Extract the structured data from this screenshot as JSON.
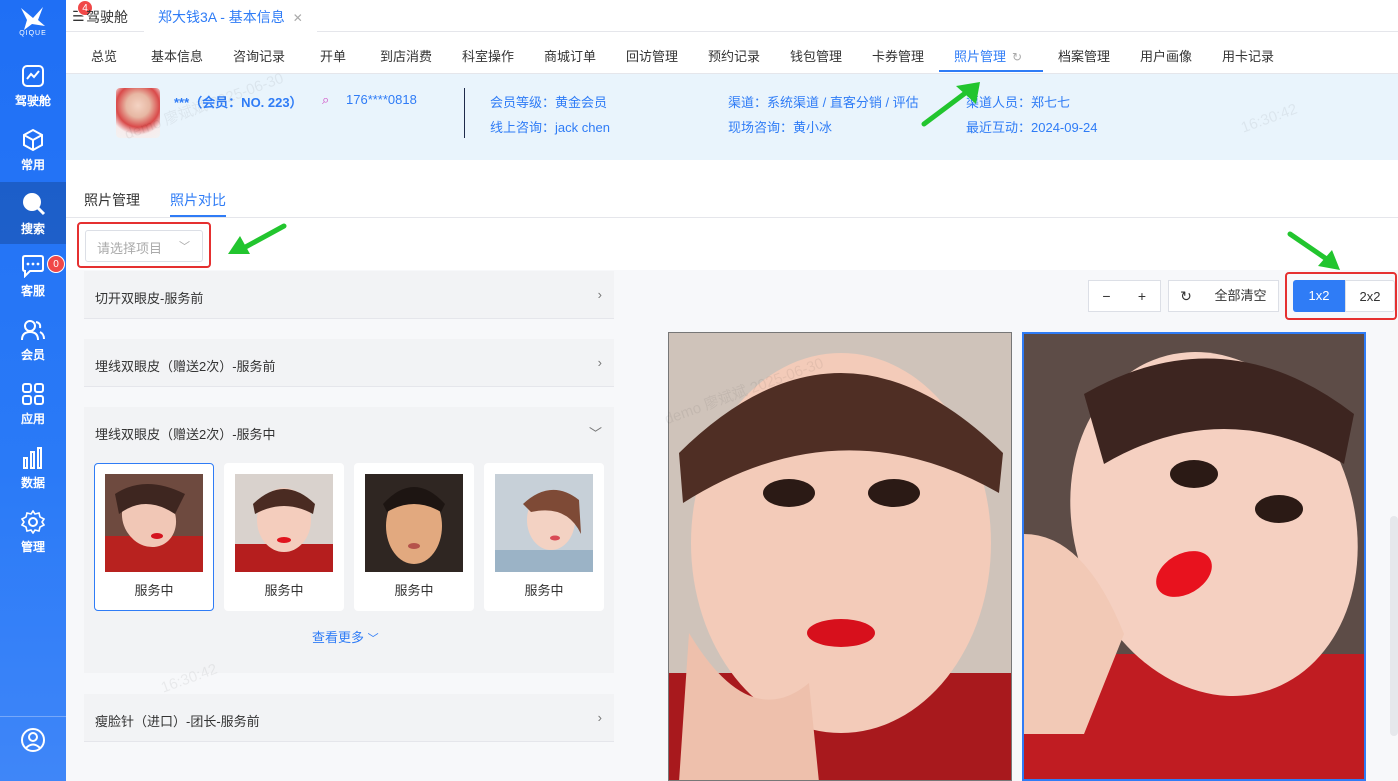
{
  "sidebar": {
    "logo_text": "QIQUE",
    "items": [
      {
        "label": "驾驶舱",
        "icon": "dashboard-icon"
      },
      {
        "label": "常用",
        "icon": "cube-icon"
      },
      {
        "label": "搜索",
        "icon": "search-icon"
      },
      {
        "label": "客服",
        "icon": "chat-icon",
        "badge": "0"
      },
      {
        "label": "会员",
        "icon": "users-icon"
      },
      {
        "label": "应用",
        "icon": "apps-icon"
      },
      {
        "label": "数据",
        "icon": "chart-icon"
      },
      {
        "label": "管理",
        "icon": "gear-icon"
      }
    ],
    "active_index": 2
  },
  "topbar": {
    "badge": "4",
    "tab_home": "驾驶舱",
    "tab_current": "郑大钱3A - 基本信息"
  },
  "modules": [
    "总览",
    "基本信息",
    "咨询记录",
    "开单",
    "到店消费",
    "科室操作",
    "商城订单",
    "回访管理",
    "预约记录",
    "钱包管理",
    "卡券管理",
    "照片管理",
    "档案管理",
    "用户画像",
    "用卡记录"
  ],
  "active_module": "照片管理",
  "member": {
    "name": "***（会员：NO. 223）",
    "phone": "176****0818",
    "level_label": "会员等级：",
    "level": "黄金会员",
    "online_label": "线上咨询：",
    "online": "jack chen",
    "channel_label": "渠道：",
    "channel": "系统渠道 / 直客分销 / 评估",
    "onsite_label": "现场咨询：",
    "onsite": "黄小冰",
    "staff_label": "渠道人员：",
    "staff": "郑七七",
    "recent_label": "最近互动：",
    "recent": "2024-09-24"
  },
  "subtabs": [
    "照片管理",
    "照片对比"
  ],
  "active_subtab": "照片对比",
  "project_select": {
    "placeholder": "请选择项目"
  },
  "groups": [
    {
      "title": "切开双眼皮-服务前",
      "expanded": false
    },
    {
      "title": "埋线双眼皮（赠送2次）-服务前",
      "expanded": false
    },
    {
      "title": "埋线双眼皮（赠送2次）-服务中",
      "expanded": true
    },
    {
      "title": "瘦脸针（进口）-团长-服务前",
      "expanded": false
    }
  ],
  "photos": [
    {
      "label": "服务中",
      "selected": true
    },
    {
      "label": "服务中",
      "selected": false
    },
    {
      "label": "服务中",
      "selected": false
    },
    {
      "label": "服务中",
      "selected": false
    }
  ],
  "view_more": "查看更多",
  "toolbar": {
    "zoom_out": "−",
    "zoom_in": "+",
    "clear_all": "全部清空"
  },
  "layouts": {
    "options": [
      "1x2",
      "2x2"
    ],
    "active": "1x2"
  },
  "watermark": {
    "name": "demo 廖斌斌",
    "date": "2025-06-30",
    "time": "16:30:42"
  },
  "colors": {
    "primary": "#2f7cf6",
    "sidebar": "#1f6ff5",
    "highlight_box": "#e53030",
    "annotation_arrow": "#22c52e"
  }
}
